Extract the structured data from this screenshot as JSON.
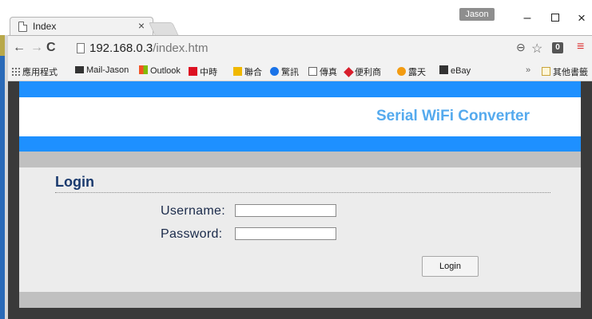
{
  "window": {
    "user": "Jason",
    "minimize": "–",
    "close": "×"
  },
  "tab": {
    "title": "Index",
    "close": "×"
  },
  "address_bar": {
    "host": "192.168.0.3",
    "path": "/index.htm"
  },
  "bookmarks": [
    {
      "label": "應用程式",
      "icon": "apps-grid-icon"
    },
    {
      "label": "Mail-Jason",
      "icon": "mail-icon"
    },
    {
      "label": "Outlook",
      "icon": "windows-logo-icon"
    },
    {
      "label": "中時",
      "icon": "chinatimes-icon"
    },
    {
      "label": "聯合",
      "icon": "udn-icon"
    },
    {
      "label": "驚訊",
      "icon": "news-icon"
    },
    {
      "label": "傳真",
      "icon": "page-icon"
    },
    {
      "label": "便利商",
      "icon": "store-icon"
    },
    {
      "label": "露天",
      "icon": "ruten-icon"
    },
    {
      "label": "eBay",
      "icon": "ebay-icon"
    }
  ],
  "bookmarks_more": "»",
  "bookmarks_other": "其他書籤",
  "page": {
    "brand": "Serial WiFi Converter",
    "login_title": "Login",
    "username_label": "Username:",
    "password_label": "Password:",
    "username_value": "",
    "password_value": "",
    "login_button": "Login"
  },
  "colors": {
    "band": "#1e90ff",
    "brand": "#55aaee",
    "login_title": "#1a3a6e"
  }
}
